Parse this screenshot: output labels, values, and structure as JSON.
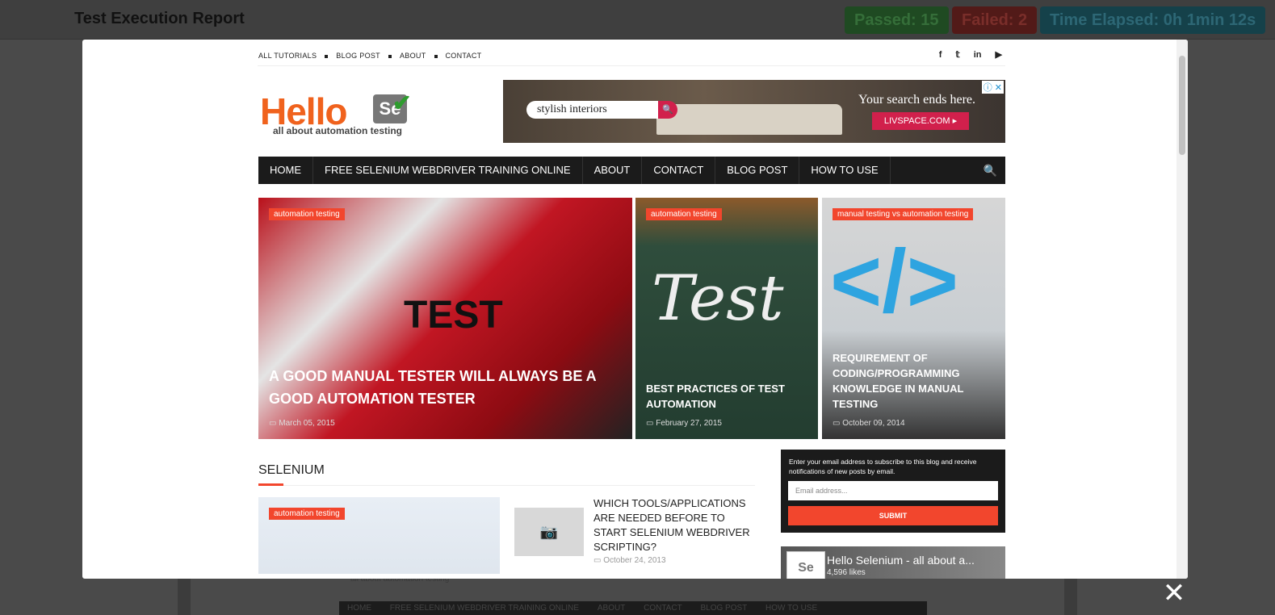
{
  "report": {
    "title": "Test Execution Report",
    "passed": "Passed: 15",
    "failed": "Failed: 2",
    "time_elapsed": "Time Elapsed: 0h 1min 12s",
    "bg_tagline": "all about automation testing",
    "bg_nav": [
      "HOME",
      "FREE SELENIUM WEBDRIVER TRAINING ONLINE",
      "ABOUT",
      "CONTACT",
      "BLOG POST",
      "HOW TO USE"
    ]
  },
  "modal": {
    "close_label": "✕"
  },
  "site": {
    "top_nav": [
      "ALL TUTORIALS",
      "BLOG POST",
      "ABOUT",
      "CONTACT"
    ],
    "social_icons": [
      "facebook-icon",
      "twitter-icon",
      "linkedin-icon",
      "youtube-icon"
    ],
    "logo": {
      "text": "Hello",
      "badge": "Se",
      "tagline": "all about automation testing"
    },
    "ad": {
      "search_value": "stylish interiors",
      "headline": "Your search ends here.",
      "button": "LIVSPACE.COM ▸",
      "ad_icons": "ⓘ ✕"
    },
    "main_nav": [
      "HOME",
      "FREE SELENIUM WEBDRIVER TRAINING ONLINE",
      "ABOUT",
      "CONTACT",
      "BLOG POST",
      "HOW TO USE"
    ],
    "featured": [
      {
        "category": "automation testing",
        "title": "A GOOD MANUAL TESTER WILL ALWAYS BE A GOOD AUTOMATION TESTER",
        "date": "March 05, 2015",
        "image_text": "TEST"
      },
      {
        "category": "automation testing",
        "title": "BEST PRACTICES OF TEST AUTOMATION",
        "date": "February 27, 2015",
        "image_text": "Test"
      },
      {
        "category": "manual testing vs automation testing",
        "title": "REQUIREMENT OF CODING/PROGRAMMING KNOWLEDGE IN MANUAL TESTING",
        "date": "October 09, 2014",
        "image_text": "</>"
      }
    ],
    "section_title": "SELENIUM",
    "posts": [
      {
        "category": "automation testing"
      },
      {
        "title": "WHICH TOOLS/APPLICATIONS ARE NEEDED BEFORE TO START SELENIUM WEBDRIVER SCRIPTING?",
        "date": "October 24, 2013"
      }
    ],
    "subscribe": {
      "text": "Enter your email address to subscribe to this blog and receive notifications of new posts by email.",
      "placeholder": "Email address...",
      "button": "SUBMIT"
    },
    "facebook": {
      "title": "Hello Selenium - all about a...",
      "likes": "4,596 likes"
    }
  },
  "colors": {
    "accent": "#f2462d",
    "nav": "#1b1b1b",
    "logo_orange": "#f0621d"
  }
}
